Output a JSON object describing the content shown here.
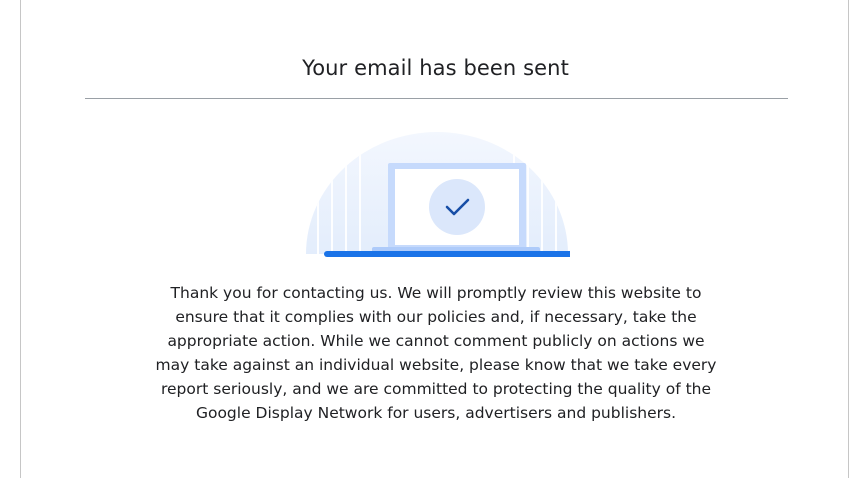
{
  "confirmation": {
    "title": "Your email has been sent",
    "message": "Thank you for contacting us. We will promptly review this website to ensure that it complies with our policies and, if necessary, take the appropriate action. While we cannot comment publicly on actions we may take against an individual website, please know that we take every report seriously, and we are committed to protecting the quality of the Google Display Network for users, advertisers and publishers."
  },
  "icons": {
    "illustration": "laptop-checkmark-icon"
  },
  "colors": {
    "accent": "#1a73e8",
    "check": "#174ea6",
    "text": "#202124"
  }
}
